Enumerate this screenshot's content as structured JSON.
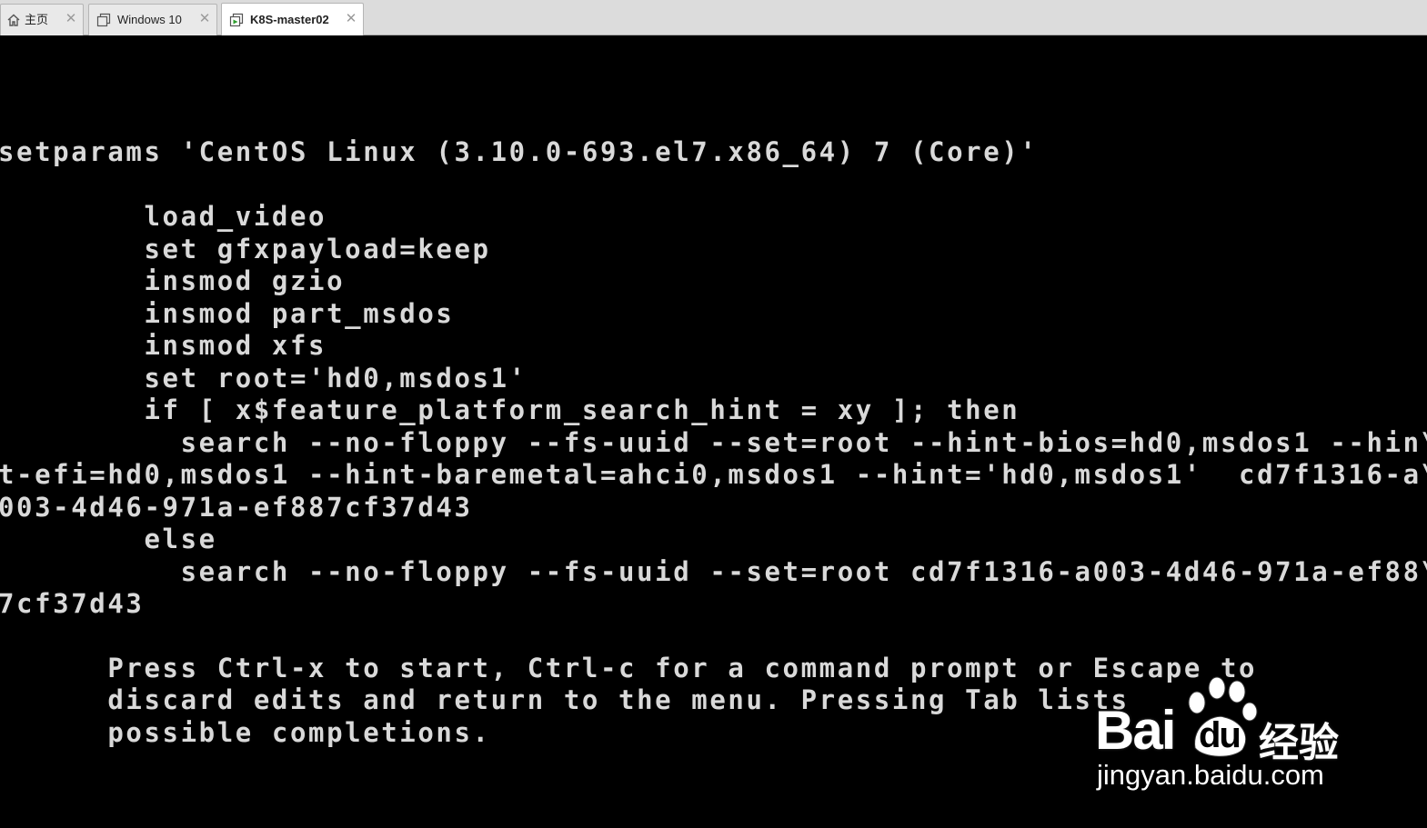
{
  "tabs": [
    {
      "label": "主页",
      "icon": "home-icon",
      "active": false
    },
    {
      "label": "Windows 10",
      "icon": "vm-icon",
      "active": false
    },
    {
      "label": "K8S-master02",
      "icon": "vm-running-icon",
      "active": true
    }
  ],
  "console": {
    "lines": [
      "setparams 'CentOS Linux (3.10.0-693.el7.x86_64) 7 (Core)'",
      "",
      "        load_video",
      "        set gfxpayload=keep",
      "        insmod gzio",
      "        insmod part_msdos",
      "        insmod xfs",
      "        set root='hd0,msdos1'",
      "        if [ x$feature_platform_search_hint = xy ]; then",
      "          search --no-floppy --fs-uuid --set=root --hint-bios=hd0,msdos1 --hin\\",
      "t-efi=hd0,msdos1 --hint-baremetal=ahci0,msdos1 --hint='hd0,msdos1'  cd7f1316-a\\",
      "003-4d46-971a-ef887cf37d43",
      "        else",
      "          search --no-floppy --fs-uuid --set=root cd7f1316-a003-4d46-971a-ef88\\",
      "7cf37d43",
      "",
      "      Press Ctrl-x to start, Ctrl-c for a command prompt or Escape to",
      "      discard edits and return to the menu. Pressing Tab lists",
      "      possible completions."
    ]
  },
  "watermark": {
    "brand_bai": "Bai",
    "brand_du": "du",
    "brand_jingyan": "经验",
    "url": "jingyan.baidu.com"
  }
}
